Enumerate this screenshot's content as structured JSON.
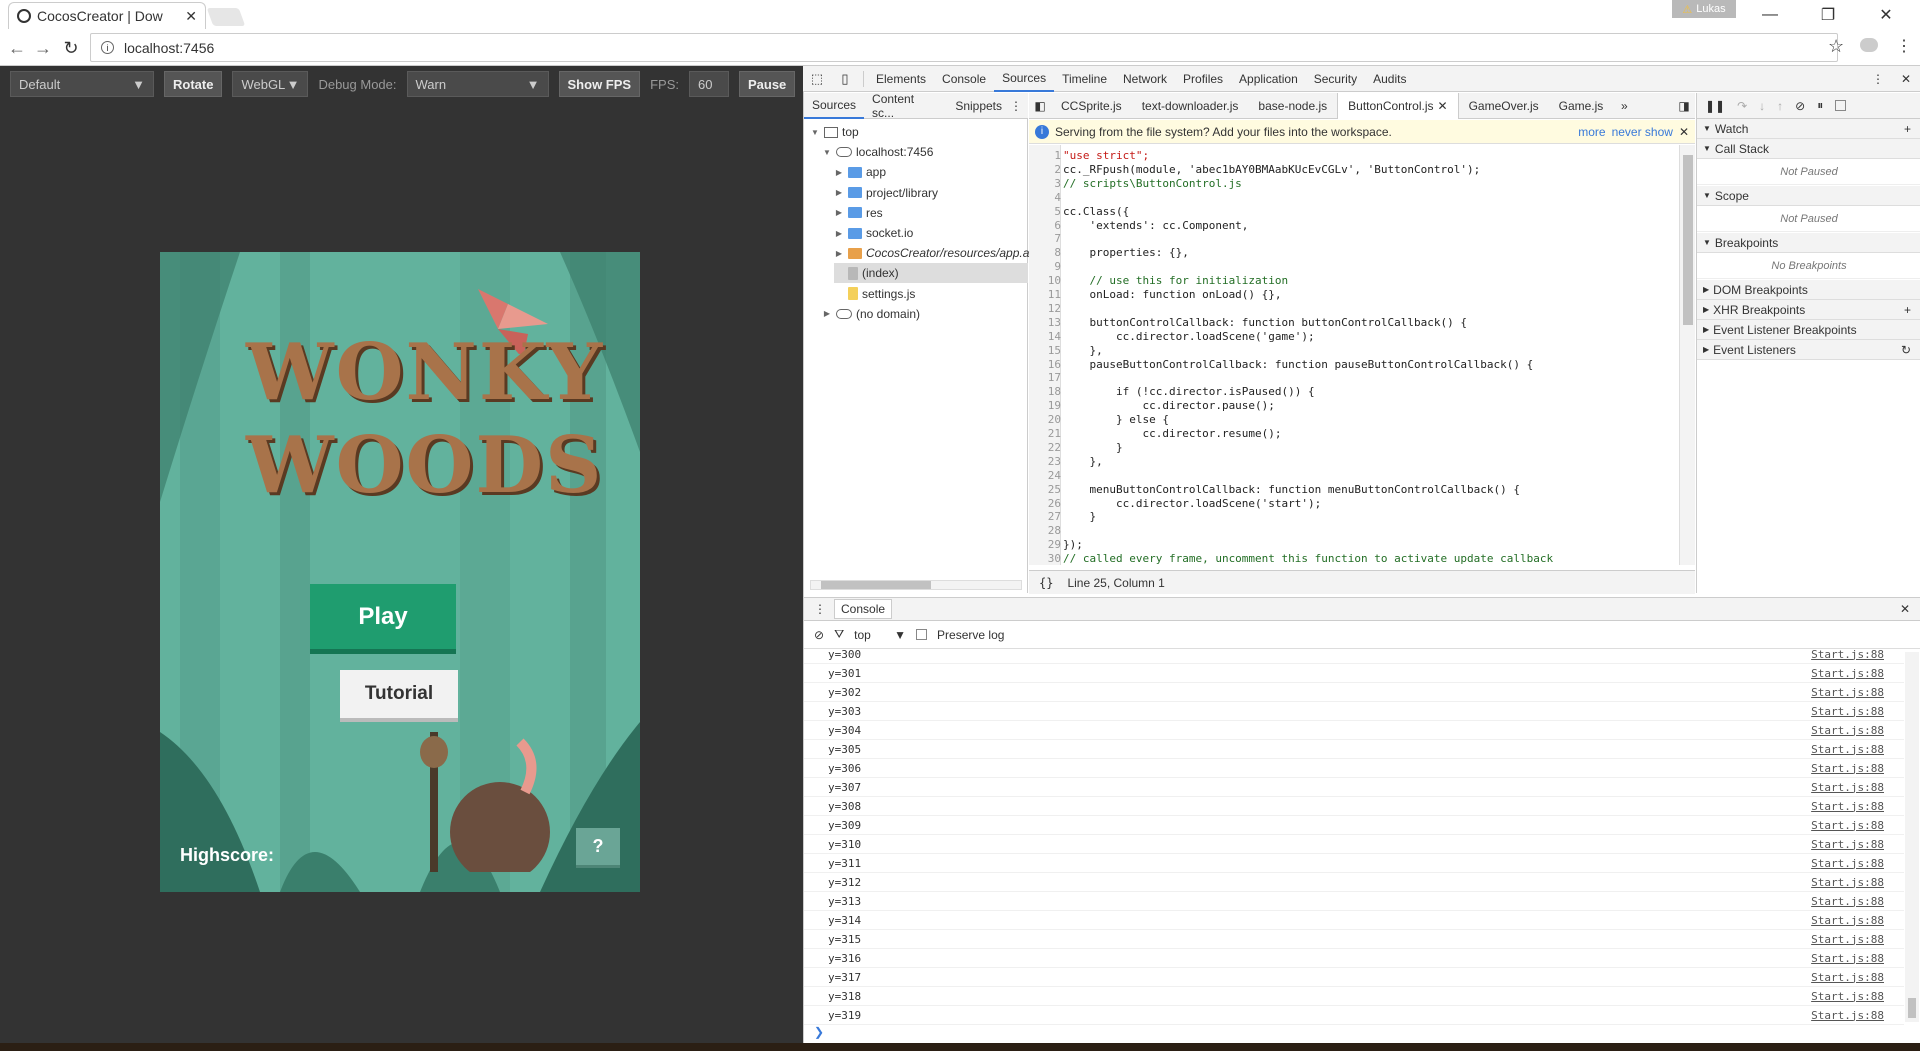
{
  "browser": {
    "tab_title": "CocosCreator | Dow",
    "user": "Lukas",
    "url": "localhost:7456"
  },
  "game_toolbar": {
    "device": "Default",
    "rotate": "Rotate",
    "renderer": "WebGL",
    "debug_label": "Debug Mode:",
    "debug_value": "Warn",
    "show_fps": "Show FPS",
    "fps_label": "FPS:",
    "fps_value": "60",
    "pause": "Pause"
  },
  "game": {
    "title_line1": "WONKY",
    "title_line2": "WOODS",
    "play": "Play",
    "tutorial": "Tutorial",
    "highscore": "Highscore:",
    "help": "?"
  },
  "devtools": {
    "tabs": [
      "Elements",
      "Console",
      "Sources",
      "Timeline",
      "Network",
      "Profiles",
      "Application",
      "Security",
      "Audits"
    ],
    "nav_tabs": [
      "Sources",
      "Content sc...",
      "Snippets"
    ],
    "tree": [
      {
        "label": "top",
        "level": 0
      },
      {
        "label": "localhost:7456",
        "level": 1
      },
      {
        "label": "app",
        "level": 2
      },
      {
        "label": "project/library",
        "level": 2
      },
      {
        "label": "res",
        "level": 2
      },
      {
        "label": "socket.io",
        "level": 2
      },
      {
        "label": "CocosCreator/resources/app.asa",
        "level": 2
      },
      {
        "label": "(index)",
        "level": 2
      },
      {
        "label": "settings.js",
        "level": 2
      },
      {
        "label": "(no domain)",
        "level": 1
      }
    ],
    "editor_tabs": [
      "CCSprite.js",
      "text-downloader.js",
      "base-node.js",
      "ButtonControl.js",
      "GameOver.js",
      "Game.js"
    ],
    "info": "Serving from the file system? Add your files into the workspace.",
    "info_more": "more",
    "info_never": "never show",
    "code": [
      "\"use strict\";",
      "cc._RFpush(module, 'abec1bAY0BMAabKUcEvCGLv', 'ButtonControl');",
      "// scripts\\ButtonControl.js",
      "",
      "cc.Class({",
      "    'extends': cc.Component,",
      "",
      "    properties: {},",
      "",
      "    // use this for initialization",
      "    onLoad: function onLoad() {},",
      "",
      "    buttonControlCallback: function buttonControlCallback() {",
      "        cc.director.loadScene('game');",
      "    },",
      "    pauseButtonControlCallback: function pauseButtonControlCallback() {",
      "",
      "        if (!cc.director.isPaused()) {",
      "            cc.director.pause();",
      "        } else {",
      "            cc.director.resume();",
      "        }",
      "    },",
      "",
      "    menuButtonControlCallback: function menuButtonControlCallback() {",
      "        cc.director.loadScene('start');",
      "    }",
      "",
      "});",
      "// called every frame, uncomment this function to activate update callback"
    ],
    "status": "Line 25, Column 1",
    "right_sections": [
      {
        "label": "Watch",
        "body": ""
      },
      {
        "label": "Call Stack",
        "body": "Not Paused"
      },
      {
        "label": "Scope",
        "body": "Not Paused"
      },
      {
        "label": "Breakpoints",
        "body": "No Breakpoints"
      },
      {
        "label": "DOM Breakpoints",
        "body": ""
      },
      {
        "label": "XHR Breakpoints",
        "body": ""
      },
      {
        "label": "Event Listener Breakpoints",
        "body": ""
      },
      {
        "label": "Event Listeners",
        "body": ""
      }
    ],
    "console_tab": "Console",
    "console_context": "top",
    "preserve_log": "Preserve log",
    "console_source": "Start.js:88",
    "console_lines": [
      "y=300",
      "y=301",
      "y=302",
      "y=303",
      "y=304",
      "y=305",
      "y=306",
      "y=307",
      "y=308",
      "y=309",
      "y=310",
      "y=311",
      "y=312",
      "y=313",
      "y=314",
      "y=315",
      "y=316",
      "y=317",
      "y=318",
      "y=319"
    ]
  }
}
